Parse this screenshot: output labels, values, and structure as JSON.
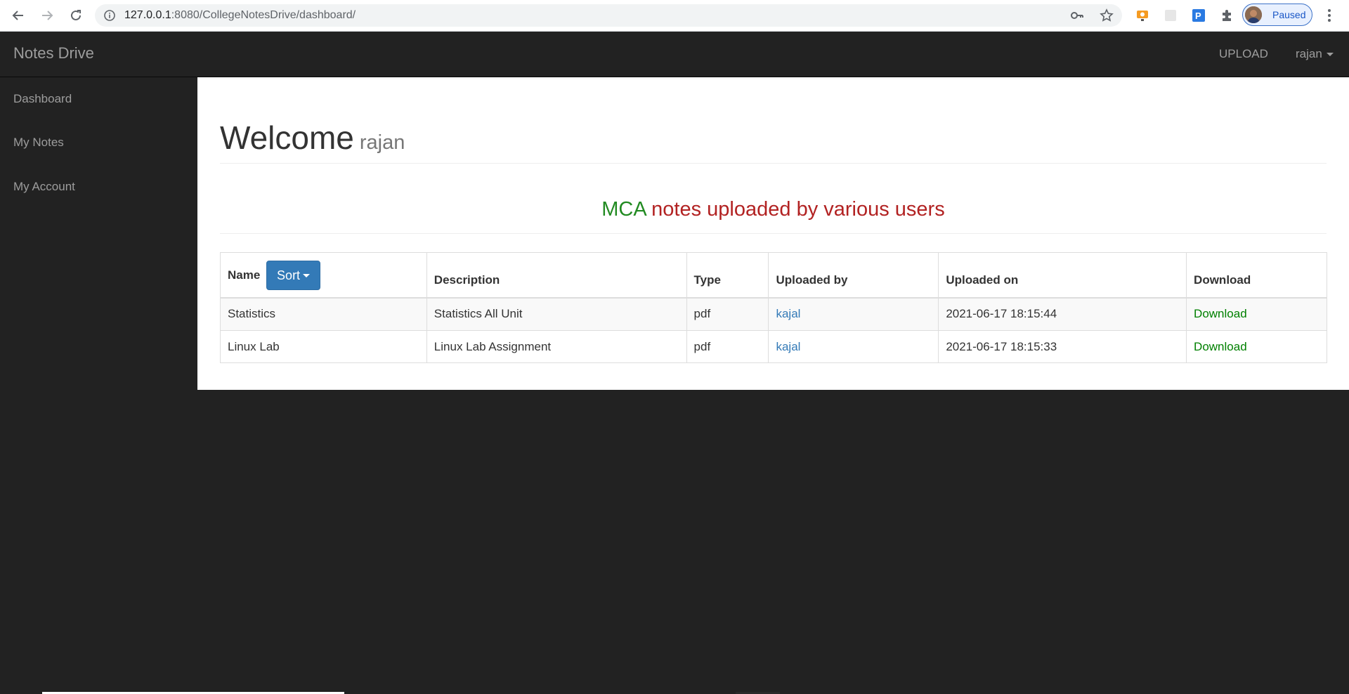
{
  "browser": {
    "url_host": "127.0.0.1",
    "url_path": ":8080/CollegeNotesDrive/dashboard/",
    "profile_status": "Paused"
  },
  "navbar": {
    "brand": "Notes Drive",
    "upload_label": "UPLOAD",
    "user_label": "rajan"
  },
  "sidebar": {
    "items": [
      {
        "label": "Dashboard"
      },
      {
        "label": "My Notes"
      },
      {
        "label": "My Account"
      }
    ]
  },
  "main": {
    "welcome_title": "Welcome",
    "welcome_user": "rajan",
    "heading_course": "MCA",
    "heading_rest": "notes uploaded by various users",
    "table": {
      "headers": {
        "name": "Name",
        "sort_label": "Sort",
        "description": "Description",
        "type": "Type",
        "uploaded_by": "Uploaded by",
        "uploaded_on": "Uploaded on",
        "download": "Download"
      },
      "rows": [
        {
          "name": "Statistics",
          "description": "Statistics All Unit",
          "type": "pdf",
          "uploaded_by": "kajal",
          "uploaded_on": "2021-06-17 18:15:44",
          "download": "Download"
        },
        {
          "name": "Linux Lab",
          "description": "Linux Lab Assignment",
          "type": "pdf",
          "uploaded_by": "kajal",
          "uploaded_on": "2021-06-17 18:15:33",
          "download": "Download"
        }
      ]
    }
  },
  "colors": {
    "navbar_bg": "#222222",
    "nav_text": "#9d9d9d",
    "course_green": "#228b22",
    "heading_red": "#b22222",
    "link_blue": "#337ab7",
    "download_green": "#008000",
    "sort_button_bg": "#337ab7"
  },
  "icons": {
    "back": "arrow-left-icon",
    "forward": "arrow-right-icon",
    "reload": "reload-icon",
    "site_info": "info-icon",
    "key": "key-icon",
    "bookmark": "star-icon",
    "extensions": "puzzle-icon",
    "menu": "kebab-menu-icon"
  }
}
